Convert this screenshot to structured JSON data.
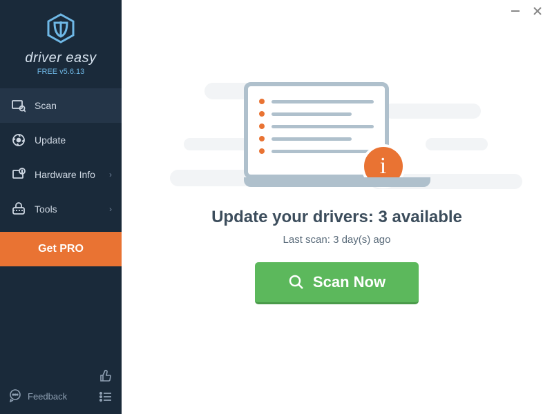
{
  "brand": {
    "name": "driver easy",
    "version_line": "FREE v5.6.13"
  },
  "sidebar": {
    "items": [
      {
        "label": "Scan",
        "active": true,
        "has_chevron": false
      },
      {
        "label": "Update",
        "active": false,
        "has_chevron": false
      },
      {
        "label": "Hardware Info",
        "active": false,
        "has_chevron": true
      },
      {
        "label": "Tools",
        "active": false,
        "has_chevron": true
      }
    ],
    "get_pro_label": "Get PRO",
    "feedback_label": "Feedback"
  },
  "main": {
    "headline": "Update your drivers: 3 available",
    "subline": "Last scan: 3 day(s) ago",
    "scan_button_label": "Scan Now"
  },
  "colors": {
    "sidebar_bg": "#1a2a3a",
    "accent_orange": "#e97333",
    "accent_green": "#5cb85c",
    "accent_blue": "#6fb8e6"
  }
}
